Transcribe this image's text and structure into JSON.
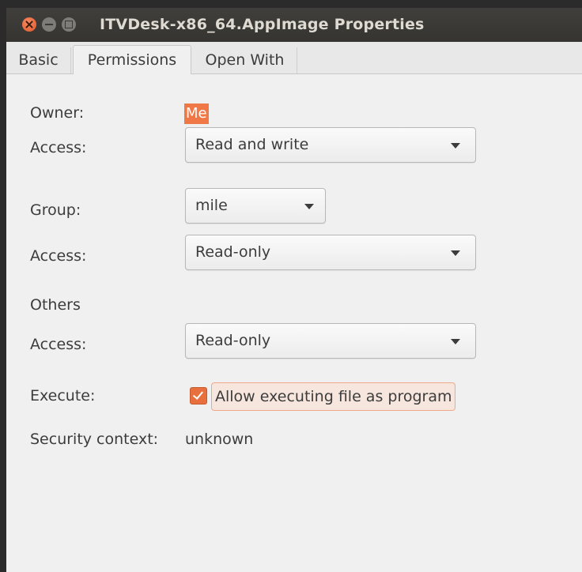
{
  "window": {
    "title": "ITVDesk-x86_64.AppImage Properties"
  },
  "tabs": [
    {
      "label": "Basic"
    },
    {
      "label": "Permissions"
    },
    {
      "label": "Open With"
    }
  ],
  "owner": {
    "label": "Owner:",
    "value": "Me",
    "access_label": "Access:",
    "access_value": "Read and write"
  },
  "group": {
    "label": "Group:",
    "value": "mile",
    "access_label": "Access:",
    "access_value": "Read-only"
  },
  "others": {
    "label": "Others",
    "access_label": "Access:",
    "access_value": "Read-only"
  },
  "execute": {
    "label": "Execute:",
    "checkbox_label": "Allow executing file as program",
    "checked": true
  },
  "security": {
    "label": "Security context:",
    "value": "unknown"
  },
  "colors": {
    "accent": "#f07746",
    "titlebar": "#3b3a36"
  }
}
